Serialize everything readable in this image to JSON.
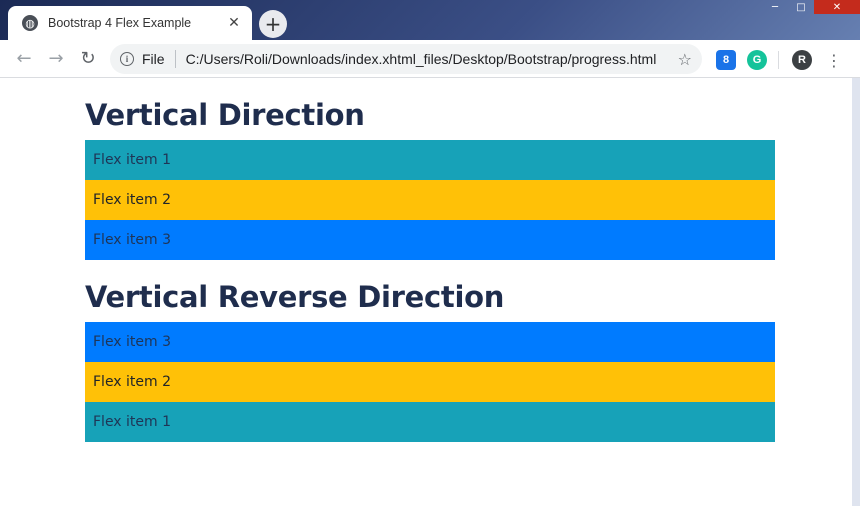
{
  "browser": {
    "tab_title": "Bootstrap 4 Flex Example",
    "tab_close": "✕",
    "new_tab": "+",
    "omnibox_scheme": "File",
    "omnibox_url": "C:/Users/Roli/Downloads/index.xhtml_files/Desktop/Bootstrap/progress.html",
    "avatar_initial": "R",
    "ext1_label": "8",
    "ext2_label": "G"
  },
  "page": {
    "section1": {
      "heading": "Vertical Direction",
      "items": [
        {
          "label": "Flex item 1",
          "color": "#17a2b8"
        },
        {
          "label": "Flex item 2",
          "color": "#ffc107"
        },
        {
          "label": "Flex item 3",
          "color": "#007bff"
        }
      ]
    },
    "section2": {
      "heading": "Vertical Reverse Direction",
      "items": [
        {
          "label": "Flex item 1",
          "color": "#17a2b8"
        },
        {
          "label": "Flex item 2",
          "color": "#ffc107"
        },
        {
          "label": "Flex item 3",
          "color": "#007bff"
        }
      ]
    }
  }
}
